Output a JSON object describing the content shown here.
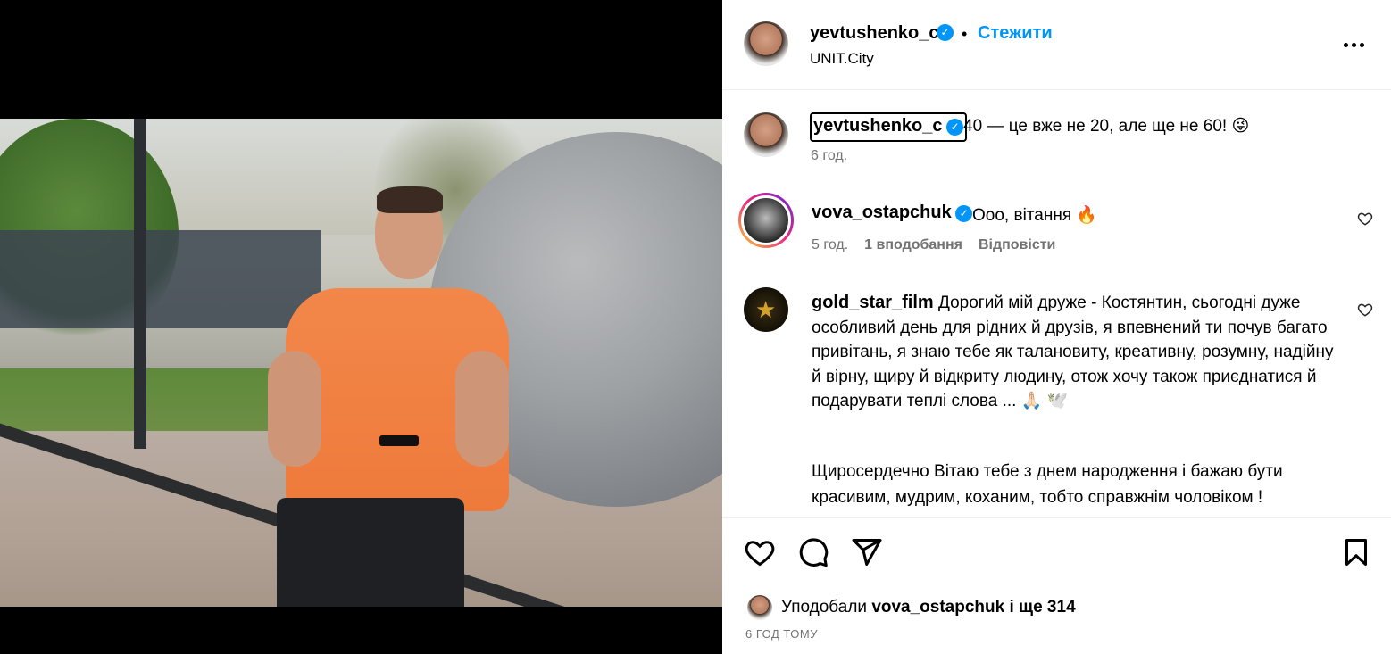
{
  "header": {
    "username": "yevtushenko_c",
    "verified_icon": "verified-badge-icon",
    "separator": "•",
    "follow_label": "Стежити",
    "location": "UNIT.City",
    "more_icon": "more-options-icon"
  },
  "caption": {
    "username": "yevtushenko_c",
    "text": "40 — це вже не 20, але ще не 60! 😜",
    "time": "6 год."
  },
  "comments": [
    {
      "username": "vova_ostapchuk",
      "text": "Ооо, вітання 🔥",
      "time": "5 год.",
      "likes": "1 вподобання",
      "reply_label": "Відповісти"
    },
    {
      "username": "gold_star_film",
      "text": "Дорогий мій друже - Костянтин, сьогодні дуже особливий день для рідних й друзів, я впевнений ти почув багато привітань, я знаю тебе як талановиту, креативну, розумну, надійну й вірну, щиру й відкриту людину, отож хочу також приєднатися й подарувати теплі слова ... 🙏🏻 🕊️",
      "text2": "Щиросердечно Вітаю тебе з днем народження і бажаю бути красивим, мудрим, коханим, тобто справжнім чоловіком !"
    }
  ],
  "likes": {
    "prefix": "Уподобали",
    "user": "vova_ostapchuk",
    "suffix": "і ще 314"
  },
  "post_time": "6 ГОД ТОМУ",
  "colors": {
    "accent": "#0095f6",
    "secondary_text": "#737373",
    "shirt": "#f2874a"
  }
}
